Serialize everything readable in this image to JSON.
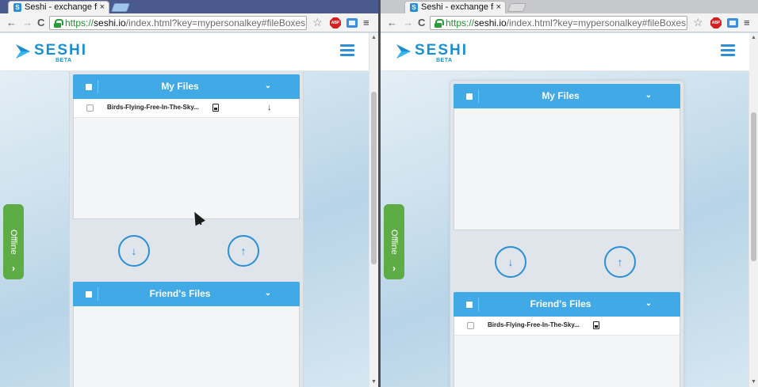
{
  "left_window": {
    "tab": {
      "title": "Seshi - exchange file",
      "favicon": "S",
      "close": "×"
    },
    "toolbar": {
      "back": "←",
      "forward": "→",
      "reload": "C",
      "url_scheme": "https://",
      "url_host": "seshi.io",
      "url_path": "/index.html?key=mypersonalkey#fileBoxes",
      "star": "☆",
      "abp": "ABP",
      "menu": "≡"
    },
    "header": {
      "logo_text": "SESHI",
      "logo_badge": "BETA"
    },
    "side_tab": {
      "label": "Offline",
      "arrow": "›",
      "color": "#5dac46"
    },
    "my_files": {
      "title": "My Files",
      "chevron": "⌄",
      "files": [
        {
          "name": "Birds-Flying-Free-In-The-Sky..."
        }
      ],
      "download_arrow": "↓"
    },
    "buttons": {
      "download_icon": "↓",
      "upload_icon": "↑"
    },
    "friends_files": {
      "title": "Friend's Files",
      "chevron": "⌄",
      "files": []
    }
  },
  "right_window": {
    "tab": {
      "title": "Seshi - exchange file",
      "favicon": "S",
      "close": "×"
    },
    "toolbar": {
      "back": "←",
      "forward": "→",
      "reload": "C",
      "url_scheme": "https://",
      "url_host": "seshi.io",
      "url_path": "/index.html?key=mypersonalkey#fileBoxes",
      "star": "☆",
      "abp": "ABP",
      "menu": "≡"
    },
    "header": {
      "logo_text": "SESHI",
      "logo_badge": "BETA"
    },
    "side_tab": {
      "label": "Offline",
      "arrow": "›",
      "color": "#5dac46"
    },
    "my_files": {
      "title": "My Files",
      "chevron": "⌄",
      "files": []
    },
    "buttons": {
      "download_icon": "↓",
      "upload_icon": "↑"
    },
    "friends_files": {
      "title": "Friend's Files",
      "chevron": "⌄",
      "files": [
        {
          "name": "Birds-Flying-Free-In-The-Sky..."
        }
      ]
    }
  },
  "colors": {
    "accent": "#40a9e6",
    "brand": "#1c8fd0",
    "offline": "#5dac46"
  }
}
